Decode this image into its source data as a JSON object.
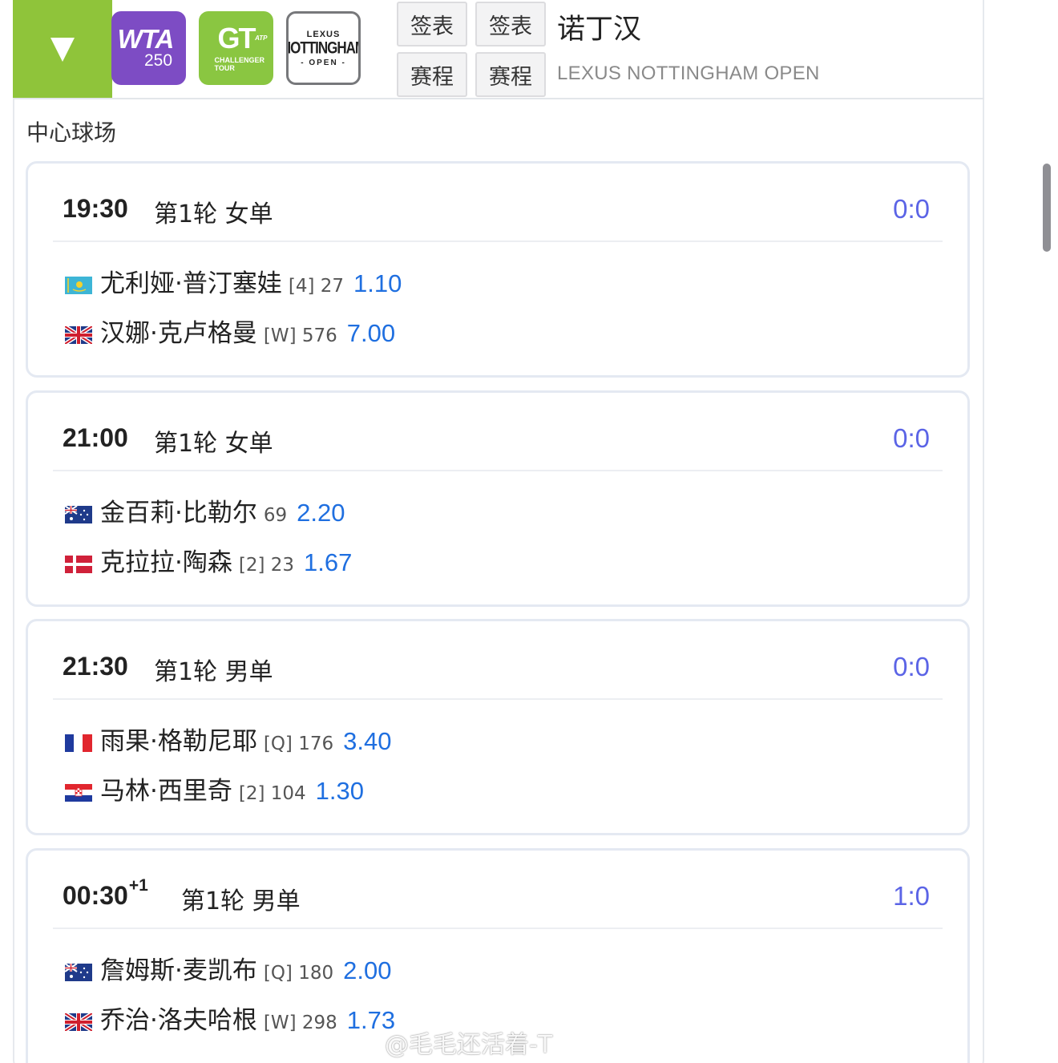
{
  "header": {
    "toggle_icon": "triangle-down-icon",
    "logos": {
      "wta_line1": "WTA",
      "wta_line2": "250",
      "challenger_mark": "GT",
      "challenger_atp": "ATP",
      "challenger_line1": "CHALLENGER",
      "challenger_line2": "TOUR",
      "nottingham_brand": "LEXUS",
      "nottingham_name": "NOTTINGHAM",
      "nottingham_open": "- OPEN -"
    },
    "buttons": {
      "draw_1": "签表",
      "draw_2": "签表",
      "schedule_1": "赛程",
      "schedule_2": "赛程"
    },
    "tournament_name": "诺丁汉",
    "tournament_name_en": "LEXUS NOTTINGHAM OPEN"
  },
  "court_name": "中心球场",
  "matches": [
    {
      "time": "19:30",
      "time_sup": "",
      "round": "第1轮 女单",
      "score": "0:0",
      "players": [
        {
          "flag": "kazakhstan-flag-icon",
          "name": "尤利娅·普汀塞娃",
          "info": "[4] 27",
          "odds": "1.10"
        },
        {
          "flag": "uk-flag-icon",
          "name": "汉娜·克卢格曼",
          "info": "[W] 576",
          "odds": "7.00"
        }
      ]
    },
    {
      "time": "21:00",
      "time_sup": "",
      "round": "第1轮 女单",
      "score": "0:0",
      "players": [
        {
          "flag": "australia-flag-icon",
          "name": "金百莉·比勒尔",
          "info": "69",
          "odds": "2.20"
        },
        {
          "flag": "denmark-flag-icon",
          "name": "克拉拉·陶森",
          "info": "[2] 23",
          "odds": "1.67"
        }
      ]
    },
    {
      "time": "21:30",
      "time_sup": "",
      "round": "第1轮 男单",
      "score": "0:0",
      "players": [
        {
          "flag": "france-flag-icon",
          "name": "雨果·格勒尼耶",
          "info": "[Q] 176",
          "odds": "3.40"
        },
        {
          "flag": "croatia-flag-icon",
          "name": "马林·西里奇",
          "info": "[2] 104",
          "odds": "1.30"
        }
      ]
    },
    {
      "time": "00:30",
      "time_sup": "+1",
      "round": "第1轮 男单",
      "score": "1:0",
      "players": [
        {
          "flag": "australia-flag-icon",
          "name": "詹姆斯·麦凯布",
          "info": "[Q] 180",
          "odds": "2.00"
        },
        {
          "flag": "uk-flag-icon",
          "name": "乔治·洛夫哈根",
          "info": "[W] 298",
          "odds": "1.73"
        }
      ]
    }
  ],
  "watermark": "@毛毛还活着-T",
  "colors": {
    "toggle_bg": "#8fc43a",
    "wta_bg": "#7d4cc4",
    "challenger_bg": "#8ac641",
    "score": "#5b64e6",
    "odds": "#1f6fe0"
  }
}
